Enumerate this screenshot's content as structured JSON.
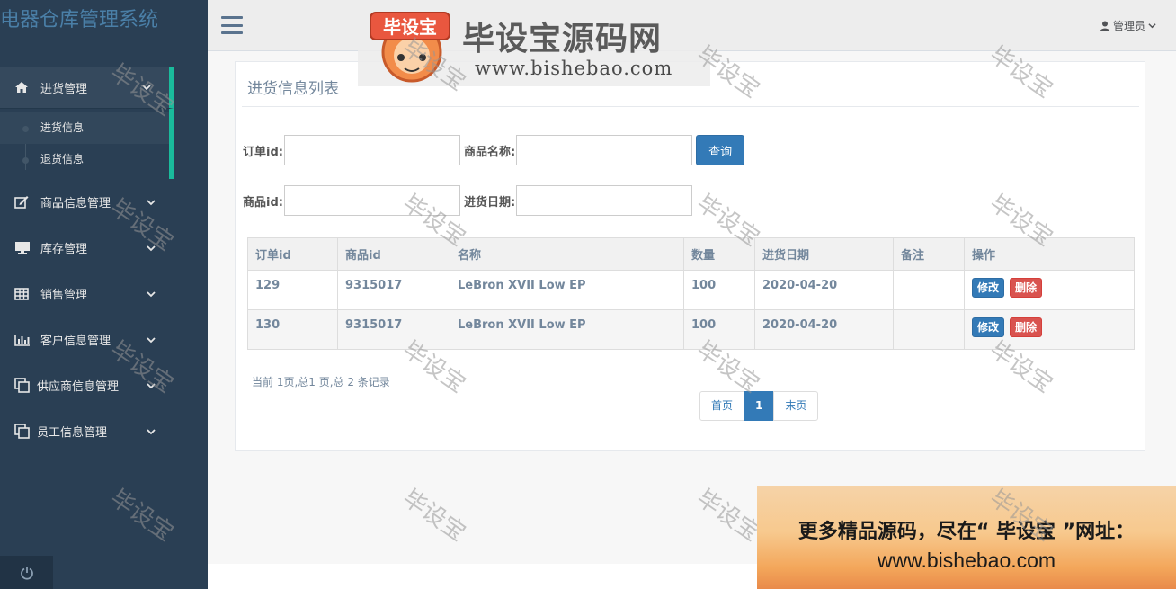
{
  "app": {
    "title": "电器仓库管理系统"
  },
  "sidebar": {
    "items": [
      {
        "label": "进货管理",
        "icon": "home-icon",
        "expanded": true,
        "children": [
          {
            "label": "进货信息",
            "current": true
          },
          {
            "label": "退货信息",
            "current": false
          }
        ]
      },
      {
        "label": "商品信息管理",
        "icon": "edit-icon"
      },
      {
        "label": "库存管理",
        "icon": "desktop-icon"
      },
      {
        "label": "销售管理",
        "icon": "table-icon"
      },
      {
        "label": "客户信息管理",
        "icon": "bar-chart-icon"
      },
      {
        "label": "供应商信息管理",
        "icon": "copy-icon"
      },
      {
        "label": "员工信息管理",
        "icon": "copy-icon"
      }
    ],
    "footer_icon": "power-icon"
  },
  "topnav": {
    "user_label": "管理员"
  },
  "panel": {
    "title": "进货信息列表",
    "search": {
      "order_id_label": "订单id:",
      "product_name_label": "商品名称:",
      "product_id_label": "商品id:",
      "date_label": "进货日期:",
      "order_id_value": "",
      "product_name_value": "",
      "product_id_value": "",
      "date_value": "",
      "query_button": "查询"
    },
    "table": {
      "headers": [
        "订单id",
        "商品id",
        "名称",
        "数量",
        "进货日期",
        "备注",
        "操作"
      ],
      "rows": [
        {
          "order_id": "129",
          "product_id": "9315017",
          "name": "LeBron XVII Low EP",
          "qty": "100",
          "date": "2020-04-20",
          "note": ""
        },
        {
          "order_id": "130",
          "product_id": "9315017",
          "name": "LeBron XVII Low EP",
          "qty": "100",
          "date": "2020-04-20",
          "note": ""
        }
      ],
      "edit_label": "修改",
      "delete_label": "删除"
    },
    "page_info": "当前 1页,总1 页,总 2 条记录",
    "pager": {
      "first": "首页",
      "current": "1",
      "last": "末页"
    }
  },
  "watermark": {
    "brand": "毕设宝源码网",
    "badge_text": "毕设宝",
    "url": "www.bishebao.com",
    "stamp": "毕设宝"
  },
  "ad": {
    "line1": "更多精品源码，尽在“ 毕设宝 ”网址：",
    "line2": "www.bishebao.com"
  },
  "colors": {
    "sidebar": "#2a3f54",
    "accent": "#1abb9c",
    "primary": "#337ab7",
    "danger": "#d9534f"
  }
}
